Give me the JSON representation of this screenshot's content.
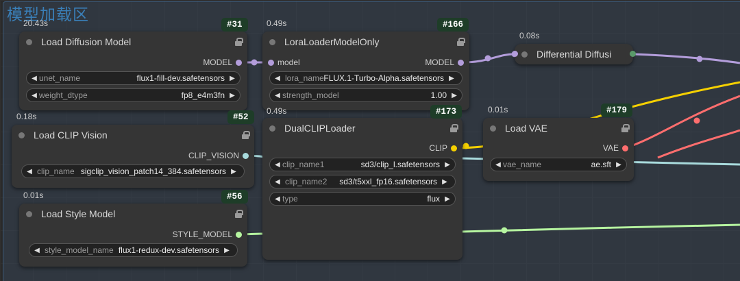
{
  "group": {
    "title": "模型加载区"
  },
  "colors": {
    "model": "#b39ddb",
    "clip": "#f5d000",
    "clip_vision": "#a8dadc",
    "vae": "#ff6e6e",
    "style_model": "#b6f5a0",
    "badge_bg": "#1e3d28"
  },
  "nodes": {
    "load_diffusion": {
      "time": "20.43s",
      "id": "#31",
      "title": "Load Diffusion Model",
      "output": "MODEL",
      "widgets": [
        {
          "label": "unet_name",
          "value": "flux1-fill-dev.safetensors"
        },
        {
          "label": "weight_dtype",
          "value": "fp8_e4m3fn"
        }
      ]
    },
    "lora": {
      "time": "0.49s",
      "id": "#166",
      "title": "LoraLoaderModelOnly",
      "input": "model",
      "output": "MODEL",
      "widgets": [
        {
          "label": "lora_name",
          "value": "FLUX.1-Turbo-Alpha.safetensors"
        },
        {
          "label": "strength_model",
          "value": "1.00"
        }
      ]
    },
    "diff_diffusion": {
      "time": "0.08s",
      "title": "Differential Diffusi"
    },
    "clip_vision": {
      "time": "0.18s",
      "id": "#52",
      "title": "Load CLIP Vision",
      "output": "CLIP_VISION",
      "widgets": [
        {
          "label": "clip_name",
          "value": "sigclip_vision_patch14_384.safetensors"
        }
      ]
    },
    "dual_clip": {
      "time": "0.49s",
      "id": "#173",
      "title": "DualCLIPLoader",
      "output": "CLIP",
      "widgets": [
        {
          "label": "clip_name1",
          "value": "sd3/clip_l.safetensors"
        },
        {
          "label": "clip_name2",
          "value": "sd3/t5xxl_fp16.safetensors"
        },
        {
          "label": "type",
          "value": "flux"
        }
      ]
    },
    "vae": {
      "time": "0.01s",
      "id": "#179",
      "title": "Load VAE",
      "output": "VAE",
      "widgets": [
        {
          "label": "vae_name",
          "value": "ae.sft"
        }
      ]
    },
    "style_model": {
      "time": "0.01s",
      "id": "#56",
      "title": "Load Style Model",
      "output": "STYLE_MODEL",
      "widgets": [
        {
          "label": "style_model_name",
          "value": "flux1-redux-dev.safetensors"
        }
      ]
    }
  }
}
